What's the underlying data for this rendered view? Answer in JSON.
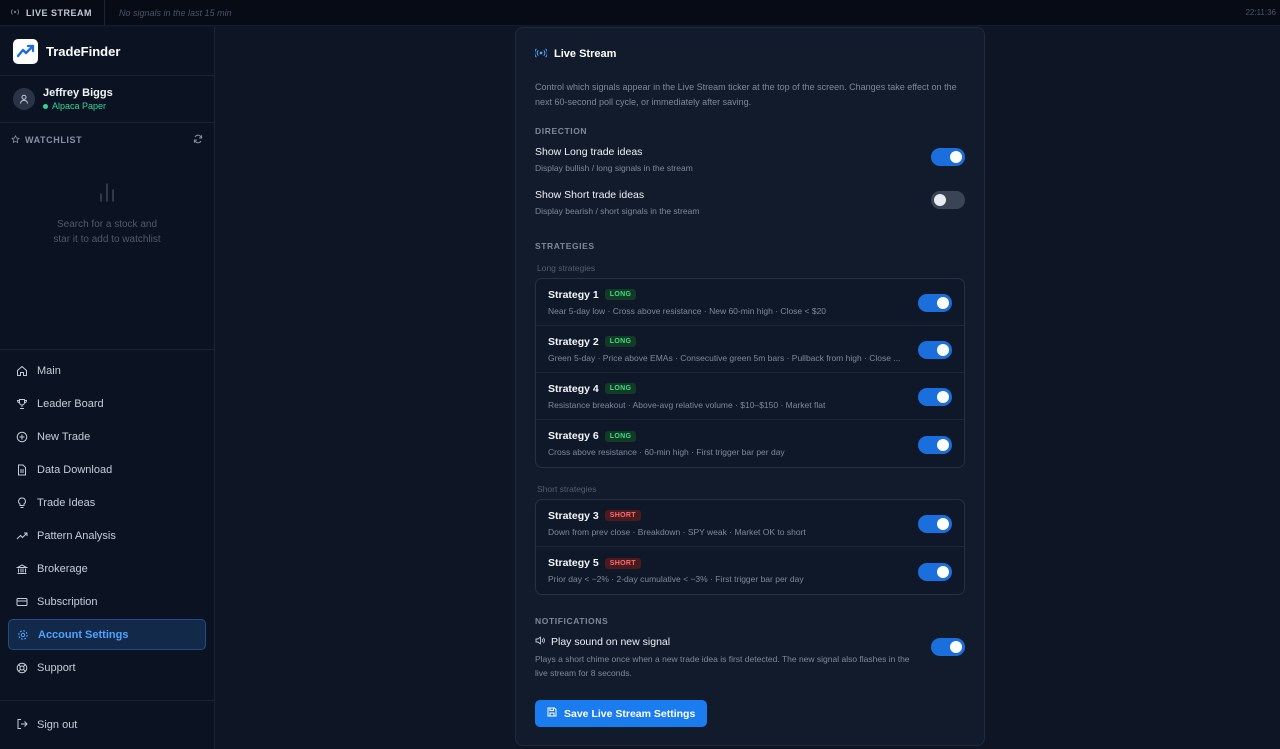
{
  "ticker": {
    "label": "LIVE STREAM",
    "message": "No signals in the last 15 min",
    "time": "22:11:36"
  },
  "sidebar": {
    "brand": "TradeFinder",
    "user": {
      "name": "Jeffrey Biggs",
      "account": "Alpaca Paper"
    },
    "watchlist": {
      "title": "WATCHLIST",
      "empty_line1": "Search for a stock and",
      "empty_line2": "star it to add to watchlist"
    },
    "nav": [
      {
        "label": "Main",
        "icon": "home-icon"
      },
      {
        "label": "Leader Board",
        "icon": "trophy-icon"
      },
      {
        "label": "New Trade",
        "icon": "plus-circle-icon"
      },
      {
        "label": "Data Download",
        "icon": "file-icon"
      },
      {
        "label": "Trade Ideas",
        "icon": "lightbulb-icon"
      },
      {
        "label": "Pattern Analysis",
        "icon": "trend-icon"
      },
      {
        "label": "Brokerage",
        "icon": "bank-icon"
      },
      {
        "label": "Subscription",
        "icon": "card-icon"
      },
      {
        "label": "Account Settings",
        "icon": "gear-icon",
        "active": true
      },
      {
        "label": "Support",
        "icon": "lifebuoy-icon"
      }
    ],
    "signout": "Sign out"
  },
  "panel": {
    "title": "Live Stream",
    "description": "Control which signals appear in the Live Stream ticker at the top of the screen. Changes take effect on the next 60-second poll cycle, or immediately after saving.",
    "direction": {
      "label": "DIRECTION",
      "long": {
        "title": "Show Long trade ideas",
        "sub": "Display bullish / long signals in the stream",
        "on": true
      },
      "short": {
        "title": "Show Short trade ideas",
        "sub": "Display bearish / short signals in the stream",
        "on": false
      }
    },
    "strategies": {
      "label": "STRATEGIES",
      "long_label": "Long strategies",
      "short_label": "Short strategies",
      "long": [
        {
          "name": "Strategy 1",
          "badge": "LONG",
          "desc": "Near 5-day low · Cross above resistance · New 60-min high · Close < $20",
          "on": true
        },
        {
          "name": "Strategy 2",
          "badge": "LONG",
          "desc": "Green 5-day · Price above EMAs · Consecutive green 5m bars · Pullback from high · Close ...",
          "on": true
        },
        {
          "name": "Strategy 4",
          "badge": "LONG",
          "desc": "Resistance breakout · Above-avg relative volume · $10–$150 · Market flat",
          "on": true
        },
        {
          "name": "Strategy 6",
          "badge": "LONG",
          "desc": "Cross above resistance · 60-min high · First trigger bar per day",
          "on": true
        }
      ],
      "short": [
        {
          "name": "Strategy 3",
          "badge": "SHORT",
          "desc": "Down from prev close · Breakdown · SPY weak · Market OK to short",
          "on": true
        },
        {
          "name": "Strategy 5",
          "badge": "SHORT",
          "desc": "Prior day < −2% · 2-day cumulative < −3% · First trigger bar per day",
          "on": true
        }
      ]
    },
    "notifications": {
      "label": "NOTIFICATIONS",
      "title": "Play sound on new signal",
      "desc": "Plays a short chime once when a new trade idea is first detected. The new signal also flashes in the live stream for 8 seconds.",
      "on": true
    },
    "save_label": "Save Live Stream Settings"
  },
  "colors": {
    "accent": "#1b7cf0",
    "long": "#3ddc84",
    "short": "#ff6b6b",
    "online": "#34d399"
  }
}
